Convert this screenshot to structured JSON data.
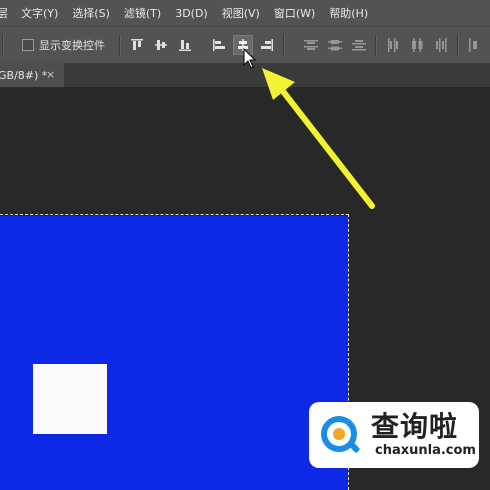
{
  "menubar": {
    "items": [
      "层",
      "文字(Y)",
      "选择(S)",
      "滤镜(T)",
      "3D(D)",
      "视图(V)",
      "窗口(W)",
      "帮助(H)"
    ]
  },
  "options": {
    "show_transform_label": "显示变换控件",
    "show_transform_checked": false,
    "tools": [
      "align-top-edges-icon",
      "align-vertical-centers-icon",
      "align-bottom-edges-icon",
      "align-left-edges-icon",
      "align-horizontal-centers-icon",
      "align-right-edges-icon",
      "distribute-top-icon",
      "distribute-vertical-centers-icon",
      "distribute-bottom-icon",
      "distribute-left-icon",
      "distribute-horizontal-centers-icon",
      "distribute-right-icon"
    ],
    "active_tool": "align-horizontal-centers-icon"
  },
  "document": {
    "tab_label": "GB/8#) *",
    "tab_close": "×"
  },
  "canvas": {
    "layer_color": "#0d29e5",
    "square_color": "#fafafa",
    "background": "#282828"
  },
  "annotation": {
    "arrow_color": "#f2f230"
  },
  "watermark": {
    "title": "查询啦",
    "url": "chaxunla.com",
    "logo_color": "#1a8ee6",
    "logo_accent": "#f5a623"
  }
}
